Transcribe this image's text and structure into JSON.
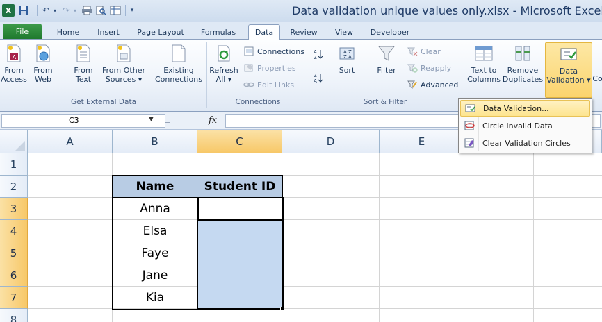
{
  "window": {
    "title": "Data validation unique values only.xlsx - Microsoft Excel"
  },
  "tabs": [
    {
      "label": "File"
    },
    {
      "label": "Home"
    },
    {
      "label": "Insert"
    },
    {
      "label": "Page Layout"
    },
    {
      "label": "Formulas"
    },
    {
      "label": "Data"
    },
    {
      "label": "Review"
    },
    {
      "label": "View"
    },
    {
      "label": "Developer"
    }
  ],
  "active_tab": "Data",
  "ribbon": {
    "get_external_data": {
      "label": "Get External Data",
      "from_access": [
        "From",
        "Access"
      ],
      "from_web": [
        "From",
        "Web"
      ],
      "from_text": [
        "From",
        "Text"
      ],
      "from_other": [
        "From Other",
        "Sources ▾"
      ],
      "existing": [
        "Existing",
        "Connections"
      ]
    },
    "connections": {
      "label": "Connections",
      "refresh": [
        "Refresh",
        "All ▾"
      ],
      "connections": "Connections",
      "properties": "Properties",
      "edit_links": "Edit Links"
    },
    "sort_filter": {
      "label": "Sort & Filter",
      "sort": "Sort",
      "filter": "Filter",
      "clear": "Clear",
      "reapply": "Reapply",
      "advanced": "Advanced"
    },
    "data_tools": {
      "text_to_columns": [
        "Text to",
        "Columns"
      ],
      "remove_duplicates": [
        "Remove",
        "Duplicates"
      ],
      "data_validation": [
        "Data",
        "Validation ▾"
      ],
      "cut_label": "Co"
    }
  },
  "dropdown": {
    "items": [
      {
        "label": "Data Validation..."
      },
      {
        "label": "Circle Invalid Data"
      },
      {
        "label": "Clear Validation Circles"
      }
    ]
  },
  "formula_bar": {
    "name_box": "C3",
    "separator": "=",
    "fx": "fx",
    "value": ""
  },
  "grid": {
    "columns": [
      "A",
      "B",
      "C",
      "D",
      "E"
    ],
    "rows": [
      "1",
      "2",
      "3",
      "4",
      "5",
      "6",
      "7",
      "8"
    ],
    "table_headers": [
      "Name",
      "Student ID"
    ],
    "names": [
      "Anna",
      "Elsa",
      "Faye",
      "Jane",
      "Kia"
    ]
  },
  "colors": {
    "excel_green": "#1f7244",
    "header_fill": "#b8cce4",
    "selection_fill": "#c5d9f1",
    "active_header": "#f7c868"
  }
}
